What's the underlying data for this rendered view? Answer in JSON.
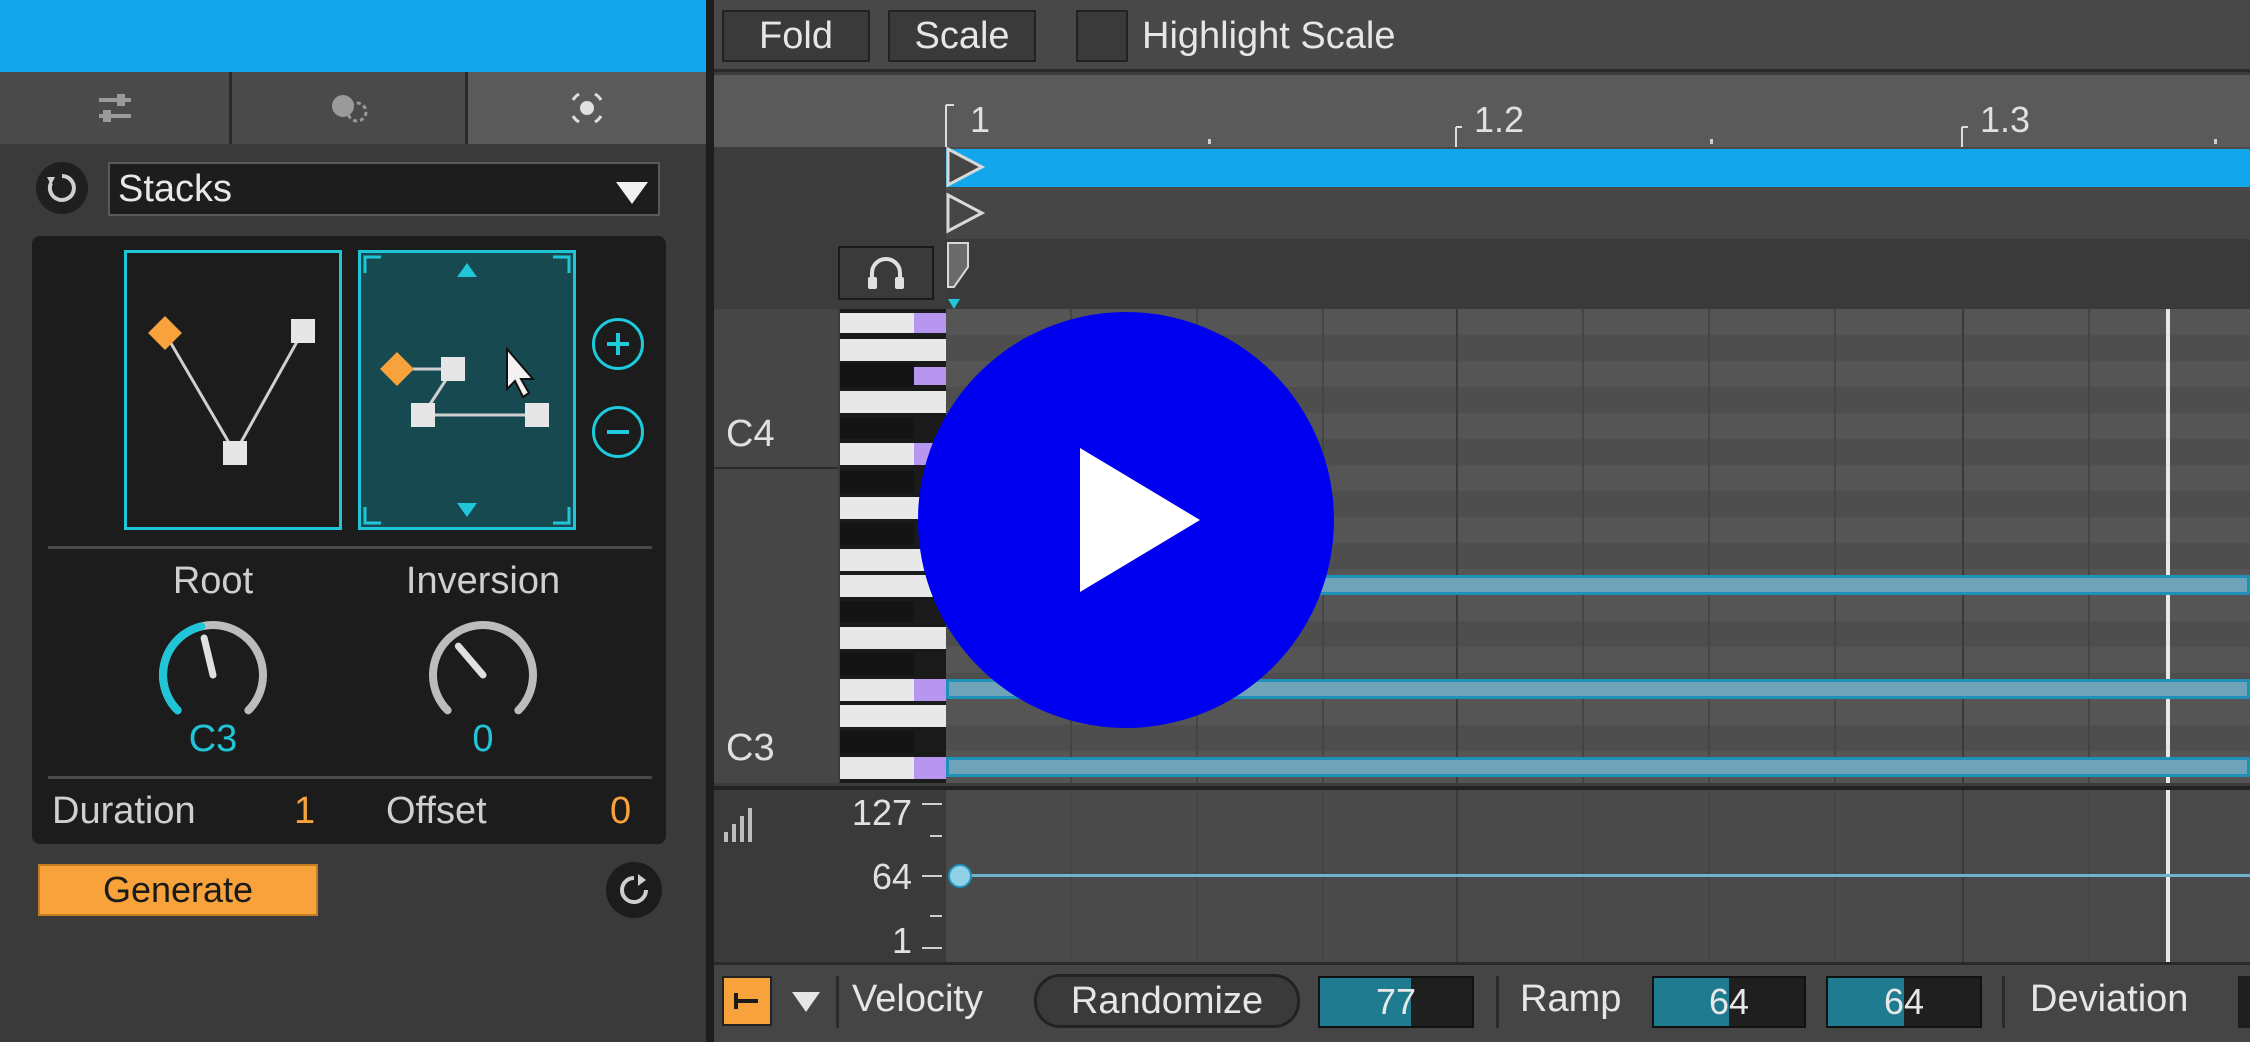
{
  "device": {
    "preset": "Stacks",
    "knobs": {
      "root": {
        "label": "Root",
        "value": "C3",
        "level": 0.45
      },
      "inversion": {
        "label": "Inversion",
        "value": "0",
        "level": 0.35
      }
    },
    "params": {
      "duration": {
        "label": "Duration",
        "value": "1"
      },
      "offset": {
        "label": "Offset",
        "value": "0"
      }
    },
    "generate_label": "Generate"
  },
  "toolbar": {
    "fold_label": "Fold",
    "scale_label": "Scale",
    "highlight_label": "Highlight Scale"
  },
  "ruler": {
    "marks": [
      "1",
      "1.2",
      "1.3"
    ]
  },
  "pitch_labels": {
    "c4": "C4",
    "c3": "C3"
  },
  "velocity": {
    "ticks": [
      "127",
      "64",
      "1"
    ]
  },
  "bottom_bar": {
    "velocity_label": "Velocity",
    "randomize_label": "Randomize",
    "velocity_value": "77",
    "ramp_label": "Ramp",
    "ramp_start": "64",
    "ramp_end": "64",
    "deviation_label": "Deviation"
  },
  "colors": {
    "accent_blue": "#12a6ec",
    "teal": "#20c6d8",
    "orange": "#f7a23a",
    "scale_highlight": "#b796f0",
    "overlay": "#0000f0"
  }
}
